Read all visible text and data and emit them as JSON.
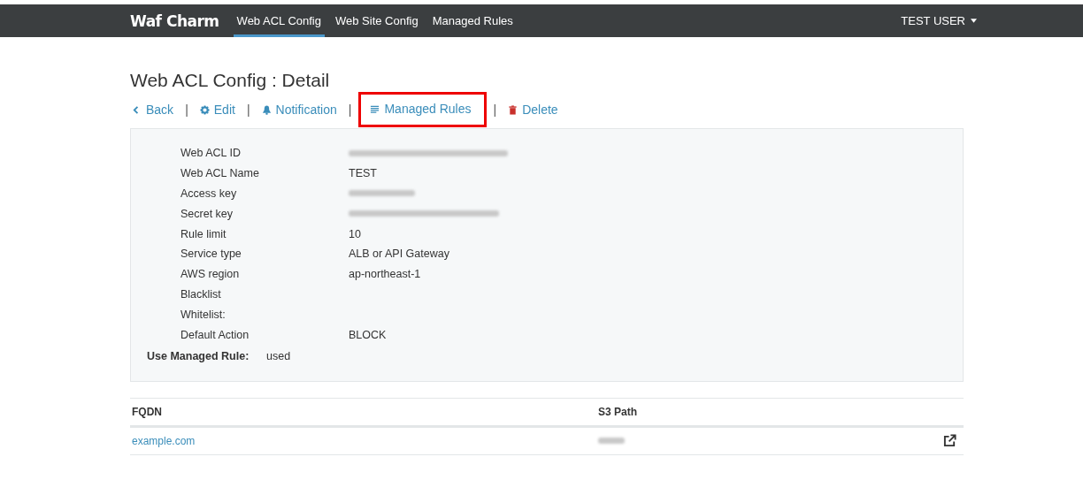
{
  "navbar": {
    "brand": "Waf Charm",
    "links": [
      {
        "label": "Web ACL Config",
        "selected": true
      },
      {
        "label": "Web Site Config",
        "selected": false
      },
      {
        "label": "Managed Rules",
        "selected": false
      }
    ],
    "user": "TEST USER"
  },
  "page_title": "Web ACL Config : Detail",
  "actions": [
    {
      "kind": "back",
      "label": "Back",
      "highlighted": false,
      "danger": false
    },
    {
      "kind": "edit",
      "separator": "|",
      "label": "Edit",
      "highlighted": false,
      "danger": false
    },
    {
      "kind": "notify",
      "separator": "|",
      "label": "Notification",
      "highlighted": false,
      "danger": false
    },
    {
      "kind": "rules",
      "separator": "|",
      "label": "Managed Rules",
      "highlighted": true,
      "danger": false
    },
    {
      "kind": "delete",
      "separator": "|",
      "label": "Delete",
      "highlighted": false,
      "danger": true
    }
  ],
  "details": [
    {
      "label": "Web ACL ID",
      "kind": "redacted"
    },
    {
      "label": "Web ACL Name",
      "kind": "text",
      "value": "TEST"
    },
    {
      "label": "Access key",
      "kind": "redacted"
    },
    {
      "label": "Secret key",
      "kind": "redacted"
    },
    {
      "label": "Rule limit",
      "kind": "text",
      "value": "10"
    },
    {
      "label": "Service type",
      "kind": "text",
      "value": "ALB or API Gateway"
    },
    {
      "label": "AWS region",
      "kind": "text",
      "value": "ap-northeast-1"
    },
    {
      "label": "Blacklist",
      "kind": "empty"
    },
    {
      "label": "Whitelist:",
      "kind": "empty"
    },
    {
      "label": "Default Action",
      "kind": "text",
      "value": "BLOCK"
    }
  ],
  "managed_rule": {
    "label": "Use Managed Rule:",
    "value": "used"
  },
  "table": {
    "columns": [
      "FQDN",
      "S3 Path"
    ],
    "rows": [
      {
        "fqdn": "example.com"
      }
    ]
  }
}
